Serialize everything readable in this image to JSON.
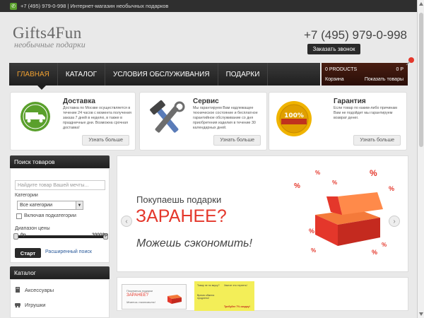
{
  "topbar": {
    "phone_icon": "phone-icon",
    "text": "+7 (495) 979-0-998 | Интернет-магазин необычных подарков"
  },
  "header": {
    "logo": "Gifts4Fun",
    "tagline": "необычные подарки",
    "phone": "+7 (495) 979-0-998",
    "call_button": "Заказать звонок"
  },
  "nav": {
    "items": [
      {
        "label": "ГЛАВНАЯ",
        "active": true
      },
      {
        "label": "КАТАЛОГ"
      },
      {
        "label": "УСЛОВИЯ ОБСЛУЖИВАНИЯ"
      },
      {
        "label": "ПОДАРКИ"
      }
    ]
  },
  "cart": {
    "products": "0 PRODUCTS",
    "total": "0 Р",
    "label": "Корзина",
    "show": "Показать товары"
  },
  "features": [
    {
      "title": "Доставка",
      "desc": "Доставка по Москве осуществляется в течение 24 часов с момента получения заказа 7 дней в неделю, в также в праздничные дни. Возможна срочная доставка!",
      "more": "Узнать больше",
      "icon": "delivery-truck-icon"
    },
    {
      "title": "Сервис",
      "desc": "Мы гарантируем Вам надлежащее техническое состояние и бесплатное гарантийное обслуживание со дня приобретения изделия в течение 30 календарных дней.",
      "more": "Узнать больше",
      "icon": "tools-icon"
    },
    {
      "title": "Гарантия",
      "desc": "Если товар по каким-либо причинам Вам не подойдет мы гарантируем возврат денег.",
      "more": "Узнать больше",
      "icon": "guarantee-seal-icon"
    }
  ],
  "search": {
    "title": "Поиск товаров",
    "placeholder": "Найдите товар Вашей мечты...",
    "categories_label": "Категории",
    "categories_value": "Все категории",
    "subcats_label": "Включая подкатегории",
    "price_label": "Диапазон цены",
    "price_min": "0р",
    "price_max": "30000р",
    "start": "Старт",
    "advanced": "Расширенный поиск"
  },
  "catalog": {
    "title": "Каталог",
    "items": [
      {
        "label": "Аксессуары",
        "icon": "accessories-icon"
      },
      {
        "label": "Игрушки",
        "icon": "toys-icon"
      }
    ]
  },
  "banner": {
    "line1": "Покупаешь подарки",
    "line2": "ЗАРАНЕЕ?",
    "line3": "Можешь сэкономить!",
    "accent": "#e4372b"
  },
  "thumbs": {
    "t1_small": "Покупаешь подарки",
    "t1_red": "ЗАРАНЕЕ?",
    "t1_small2": "Можешь сэкономить!",
    "t2_a": "Товар не по вкусу?",
    "t2_b": "Хватит это терпеть!",
    "t2_c": "Время обмена продлено!",
    "t2_d": "Требуйте 7% скидку!"
  }
}
